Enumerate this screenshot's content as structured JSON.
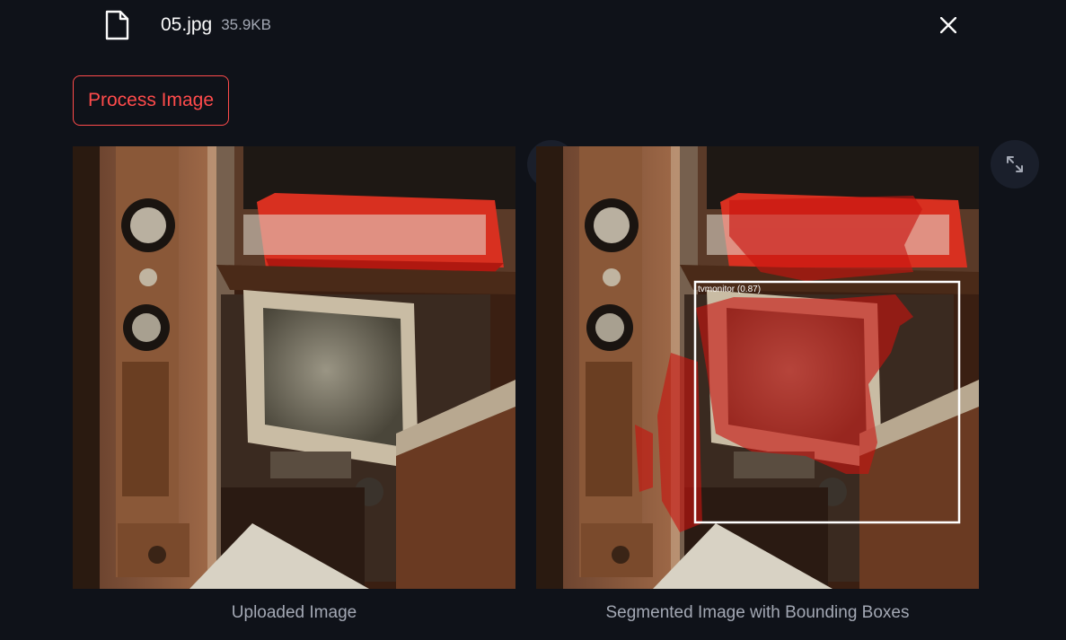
{
  "file": {
    "name": "05.jpg",
    "size": "35.9KB",
    "icon": "file-icon",
    "close_icon": "close-icon"
  },
  "actions": {
    "process_label": "Process Image"
  },
  "images": [
    {
      "caption": "Uploaded Image",
      "expand_icon": "fullscreen-icon"
    },
    {
      "caption": "Segmented Image with Bounding Boxes",
      "expand_icon": "fullscreen-icon",
      "detection": {
        "label": "tvmonitor (0.87)"
      }
    }
  ],
  "colors": {
    "background": "#0f1219",
    "accent": "#ff4b4b",
    "muted_text": "#a3a8b4",
    "overlay": "#c8140f"
  }
}
